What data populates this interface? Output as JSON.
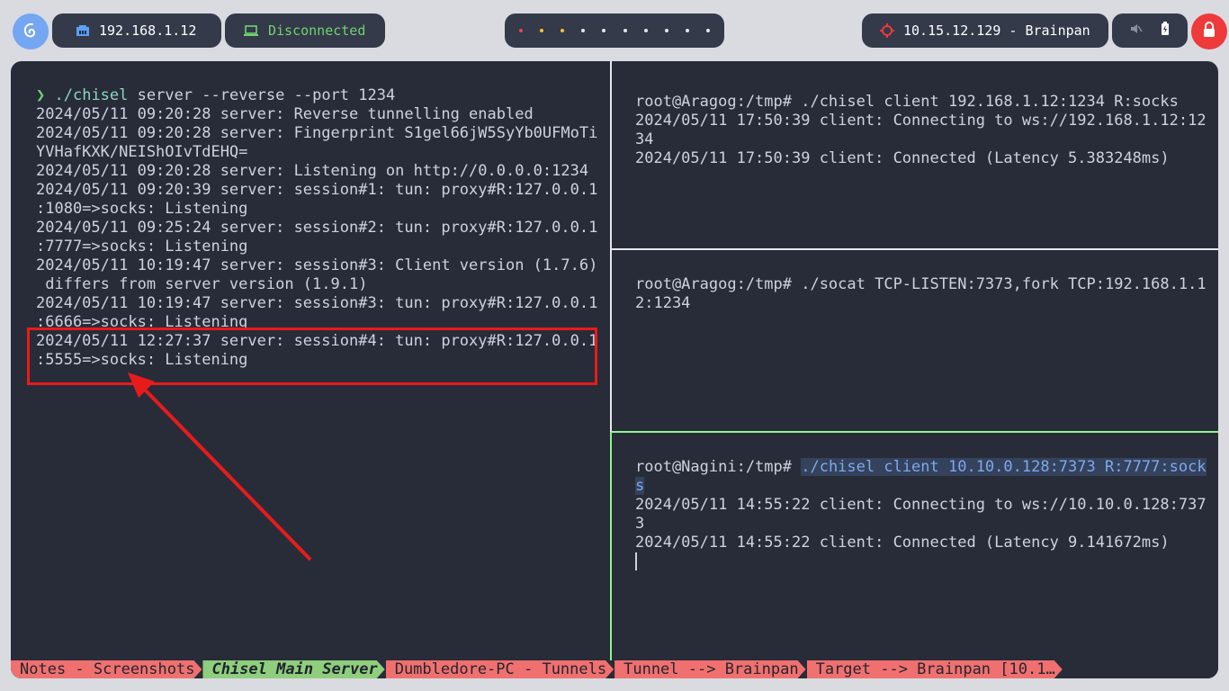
{
  "topbar": {
    "local_ip": "192.168.1.12",
    "vpn_status": "Disconnected",
    "target": "10.15.12.129 - Brainpan",
    "workspace_dot_colors": [
      "#e84a4a",
      "#f2c230",
      "#f2c230",
      "#e6e6e6",
      "#e6e6e6",
      "#e6e6e6",
      "#e6e6e6",
      "#e6e6e6",
      "#e6e6e6",
      "#e6e6e6"
    ]
  },
  "panes": {
    "left": {
      "prompt_symbol": "❯",
      "command_bin": "./chisel",
      "command_args": " server --reverse --port 1234",
      "lines": [
        "2024/05/11 09:20:28 server: Reverse tunnelling enabled",
        "2024/05/11 09:20:28 server: Fingerprint S1gel66jW5SyYb0UFMoTi",
        "YVHafKXK/NEIShOIvTdEHQ=",
        "2024/05/11 09:20:28 server: Listening on http://0.0.0.0:1234",
        "2024/05/11 09:20:39 server: session#1: tun: proxy#R:127.0.0.1",
        ":1080=>socks: Listening",
        "2024/05/11 09:25:24 server: session#2: tun: proxy#R:127.0.0.1",
        ":7777=>socks: Listening",
        "2024/05/11 10:19:47 server: session#3: Client version (1.7.6)",
        " differs from server version (1.9.1)",
        "2024/05/11 10:19:47 server: session#3: tun: proxy#R:127.0.0.1",
        ":6666=>socks: Listening",
        "2024/05/11 12:27:37 server: session#4: tun: proxy#R:127.0.0.1",
        ":5555=>socks: Listening"
      ]
    },
    "right_top": {
      "lines": [
        "root@Aragog:/tmp# ./chisel client 192.168.1.12:1234 R:socks",
        "2024/05/11 17:50:39 client: Connecting to ws://192.168.1.12:12",
        "34",
        "2024/05/11 17:50:39 client: Connected (Latency 5.383248ms)"
      ]
    },
    "right_middle": {
      "lines": [
        "root@Aragog:/tmp# ./socat TCP-LISTEN:7373,fork TCP:192.168.1.1",
        "2:1234"
      ]
    },
    "right_bottom": {
      "prompt": "root@Nagini:/tmp# ",
      "command_part1": "./chisel client 10.10.0.128:7373 R:7777:sock",
      "command_part2": "s",
      "lines": [
        "2024/05/11 14:55:22 client: Connecting to ws://10.10.0.128:737",
        "3",
        "2024/05/11 14:55:22 client: Connected (Latency 9.141672ms)"
      ]
    }
  },
  "statusbar": {
    "tabs": [
      "Notes - Screenshots",
      "Chisel Main Server",
      "Dumbledore-PC - Tunnels",
      "Tunnel --> Brainpan",
      "Target --> Brainpan [10.1…"
    ],
    "active_index": 1
  },
  "colors": {
    "terminal_bg": "#282c38",
    "annotation_red": "#e81b1b",
    "active_pane_border": "#8df58d",
    "tab_inactive": "#f07070",
    "tab_active": "#8fce7c"
  }
}
